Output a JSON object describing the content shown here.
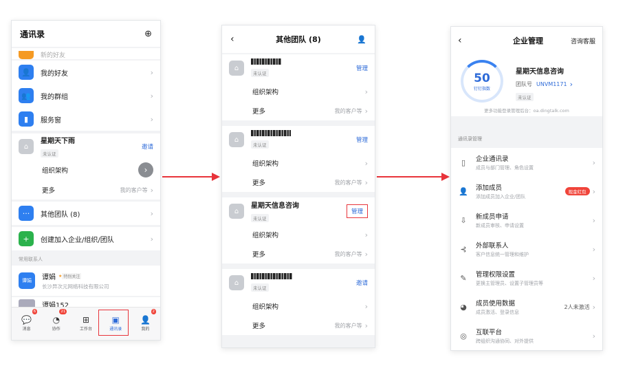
{
  "p1": {
    "title": "通讯录",
    "rows": {
      "top_partial": "新的好友",
      "my_friends": "我的好友",
      "my_groups": "我的群组",
      "service": "服务窗"
    },
    "team": {
      "name": "星期天下雨",
      "unverified": "未认证",
      "invite": "邀请",
      "org": "组织架构",
      "more": "更多",
      "more_right": "我的客户等"
    },
    "other_teams": "其他团队 (8)",
    "create_org": "创建加入企业/组织/团队",
    "section_label": "常用联系人",
    "contact1": {
      "avatar_text": "谭娟",
      "name": "谭娟",
      "tag": "特别关注",
      "company": "长沙异次元网络科技有限公司"
    },
    "contact2": {
      "name": "谭娟152"
    },
    "tabs": [
      {
        "label": "消息",
        "badge": "6",
        "icon": "chat-icon"
      },
      {
        "label": "协作",
        "badge": "21",
        "icon": "collab-icon"
      },
      {
        "label": "工作台",
        "badge": "",
        "icon": "grid-icon"
      },
      {
        "label": "通讯录",
        "badge": "",
        "icon": "contacts-icon"
      },
      {
        "label": "我的",
        "badge": "2",
        "icon": "person-icon"
      }
    ]
  },
  "p2": {
    "title": "其他团队 (8)",
    "teams": [
      {
        "manage": "管理",
        "unverified": "未认证",
        "org": "组织架构",
        "more": "更多",
        "more_right": "我的客户等"
      },
      {
        "manage": "管理",
        "unverified": "未认证",
        "org": "组织架构",
        "more": "更多",
        "more_right": "我的客户等"
      },
      {
        "name": "星期天信息咨询",
        "manage": "管理",
        "unverified": "未认证",
        "org": "组织架构",
        "more": "更多",
        "more_right": "我的客户等"
      },
      {
        "manage": "邀请",
        "unverified": "未认证",
        "org": "组织架构",
        "more": "更多",
        "more_right": "我的客户等"
      }
    ]
  },
  "p3": {
    "title": "企业管理",
    "right_action": "咨询客服",
    "score": "50",
    "score_label": "钉钉指数",
    "company": "星期天信息咨询",
    "team_no_label": "团队号",
    "team_no": "UNVM1171",
    "unverified": "未认证",
    "notice": "更多功能登录管理后台：oa.dingtalk.com",
    "section": "通讯录管理",
    "items": [
      {
        "title": "企业通讯录",
        "desc": "成员与部门管理、角色设置",
        "icon": "address-book-icon"
      },
      {
        "title": "添加成员",
        "desc": "添加成员加入企业/团队",
        "icon": "add-person-icon",
        "badge": "现金红包"
      },
      {
        "title": "新成员申请",
        "desc": "新成员审核、申请设置",
        "icon": "application-icon"
      },
      {
        "title": "外部联系人",
        "desc": "客户信息统一管理和维护",
        "icon": "external-contact-icon"
      },
      {
        "title": "管理权限设置",
        "desc": "更换主管理员、设置子管理员等",
        "icon": "permission-icon"
      },
      {
        "title": "成员使用数据",
        "desc": "成员激活、登录信息",
        "icon": "pie-chart-icon",
        "right": "2人未激活"
      },
      {
        "title": "互联平台",
        "desc": "跨组织沟通协同、对外提供",
        "icon": "globe-icon"
      }
    ]
  },
  "colors": {
    "accent": "#2e6bd8",
    "arrow": "#e8333a"
  }
}
